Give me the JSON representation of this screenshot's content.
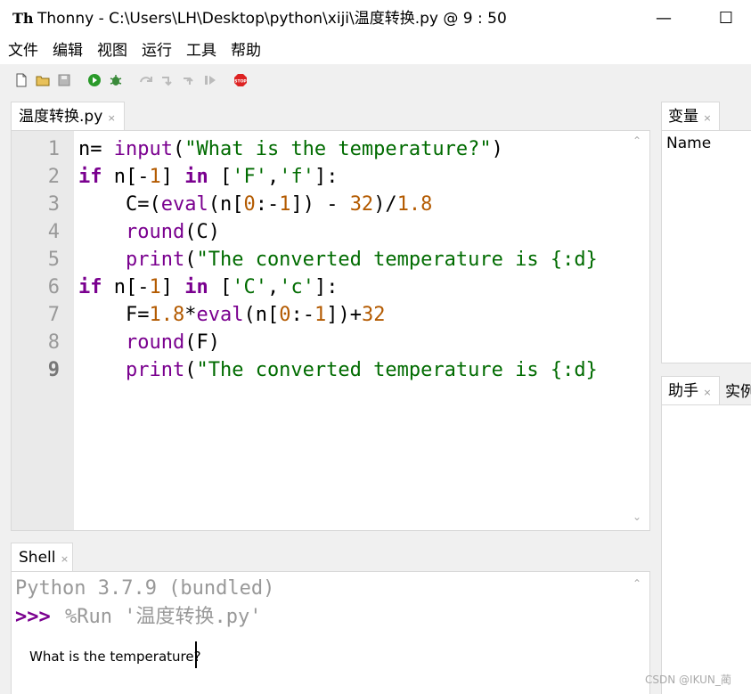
{
  "window": {
    "title": "Thonny  -  C:\\Users\\LH\\Desktop\\python\\xiji\\温度转换.py  @  9 : 50",
    "app_icon_text": "Th",
    "minimize_glyph": "—",
    "maximize_glyph": "☐"
  },
  "menu": {
    "items": [
      "文件",
      "编辑",
      "视图",
      "运行",
      "工具",
      "帮助"
    ]
  },
  "toolbar": {
    "icons": [
      "new-file-icon",
      "open-file-icon",
      "save-icon",
      "run-icon",
      "debug-icon",
      "step-over-icon",
      "step-into-icon",
      "step-out-icon",
      "resume-icon",
      "stop-icon"
    ],
    "stop_label": "STOP"
  },
  "editor": {
    "tab_label": "温度转换.py",
    "tab_close": "×",
    "line_numbers": [
      "1",
      "2",
      "3",
      "4",
      "5",
      "6",
      "7",
      "8",
      "9"
    ],
    "lines": [
      "n= input(\"What is the temperature?\")",
      "if n[-1] in ['F','f']:",
      "    C=(eval(n[0:-1]) - 32)/1.8",
      "    round(C)",
      "    print(\"The converted temperature is {:d}",
      "if n[-1] in ['C','c']:",
      "    F=1.8*eval(n[0:-1])+32",
      "    round(F)",
      "    print(\"The converted temperature is {:d}"
    ]
  },
  "shell": {
    "tab_label": "Shell",
    "tab_close": "×",
    "banner": "Python 3.7.9 (bundled)",
    "prompt": ">>>",
    "command": "%Run '温度转换.py'",
    "output": "What is the temperature?"
  },
  "variables": {
    "tab_label": "变量",
    "tab_close": "×",
    "column_name": "Name"
  },
  "assistant": {
    "tab_label": "助手",
    "tab_close": "×",
    "next_tab_label": "实例"
  },
  "watermark": "CSDN @IKUN_蔺",
  "scroll": {
    "up_glyph": "⌃",
    "down_glyph": "⌄"
  }
}
